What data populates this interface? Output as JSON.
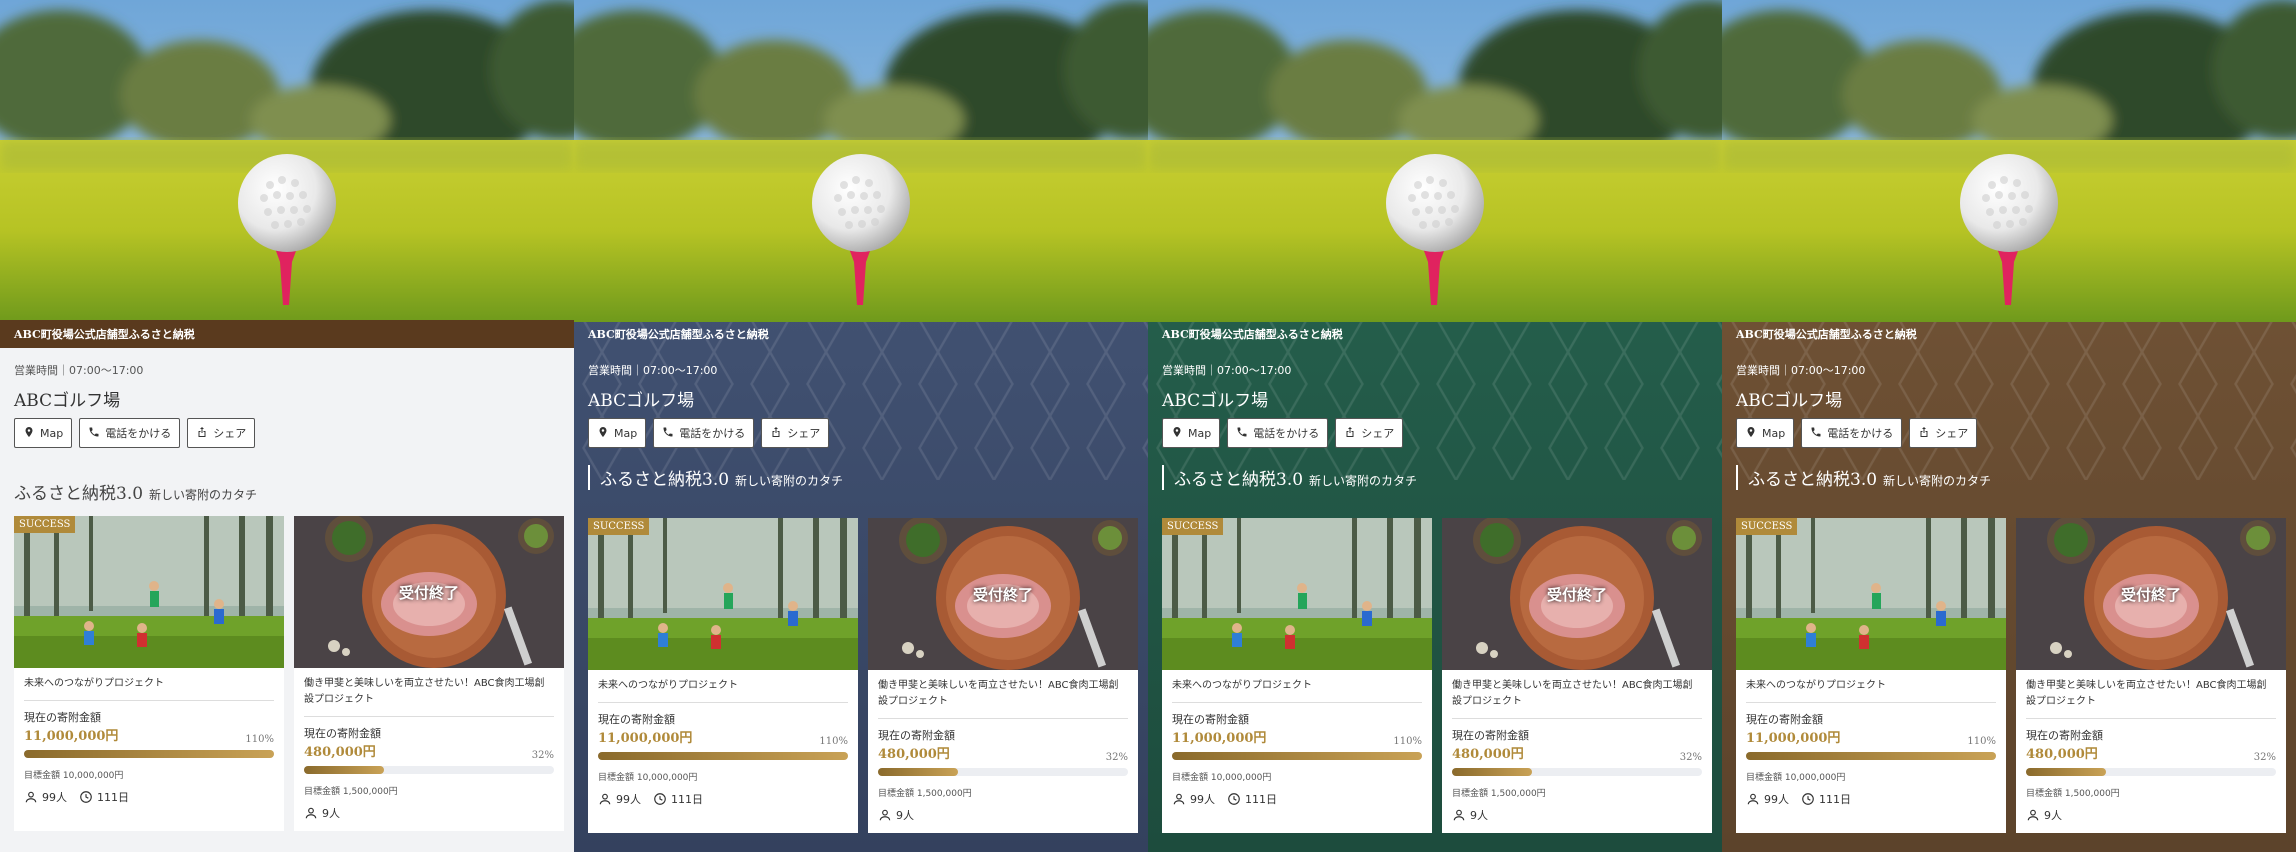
{
  "variants": [
    {
      "theme": "light",
      "tagline": "ABC町役場公式店舗型ふるさと納税",
      "hours": "営業時間｜07:00〜17:00",
      "shop_name": "ABCゴルフ場"
    },
    {
      "theme": "navy",
      "tagline": "ABC町役場公式店舗型ふるさと納税",
      "hours": "営業時間｜07:00〜17:00",
      "shop_name": "ABCゴルフ場"
    },
    {
      "theme": "green",
      "tagline": "ABC町役場公式店舗型ふるさと納税",
      "hours": "営業時間｜07:00〜17:00",
      "shop_name": "ABCゴルフ場"
    },
    {
      "theme": "brown",
      "tagline": "ABC町役場公式店舗型ふるさと納税",
      "hours": "営業時間｜07:00〜17:00",
      "shop_name": "ABCゴルフ場"
    }
  ],
  "buttons": {
    "map": "Map",
    "call": "電話をかける",
    "share": "シェア"
  },
  "section": {
    "title": "ふるさと納税3.0",
    "subtitle": "新しい寄附のカタチ"
  },
  "projects": [
    {
      "badge": "SUCCESS",
      "title": "未来へのつながりプロジェクト",
      "amount_label": "現在の寄附金額",
      "amount": "11,000,000円",
      "percent_label": "110%",
      "progress": 1.1,
      "target": "目標金額 10,000,000円",
      "supporters": "99人",
      "days": "111日"
    },
    {
      "closed": "受付終了",
      "title": "働き甲斐と美味しいを両立させたい！ABC食肉工場創設プロジェクト",
      "amount_label": "現在の寄附金額",
      "amount": "480,000円",
      "percent_label": "32%",
      "progress": 0.32,
      "target": "目標金額 1,500,000円",
      "supporters": "9人"
    }
  ],
  "colors": {
    "accent": "#b08a3a",
    "navy": "#3f4f6f",
    "green": "#235b49",
    "brown": "#6c4f33",
    "tagbar_light": "#5a3a1e"
  },
  "icons": {
    "map": "map-pin-icon",
    "call": "phone-icon",
    "share": "share-icon",
    "people": "person-icon",
    "clock": "clock-icon"
  }
}
